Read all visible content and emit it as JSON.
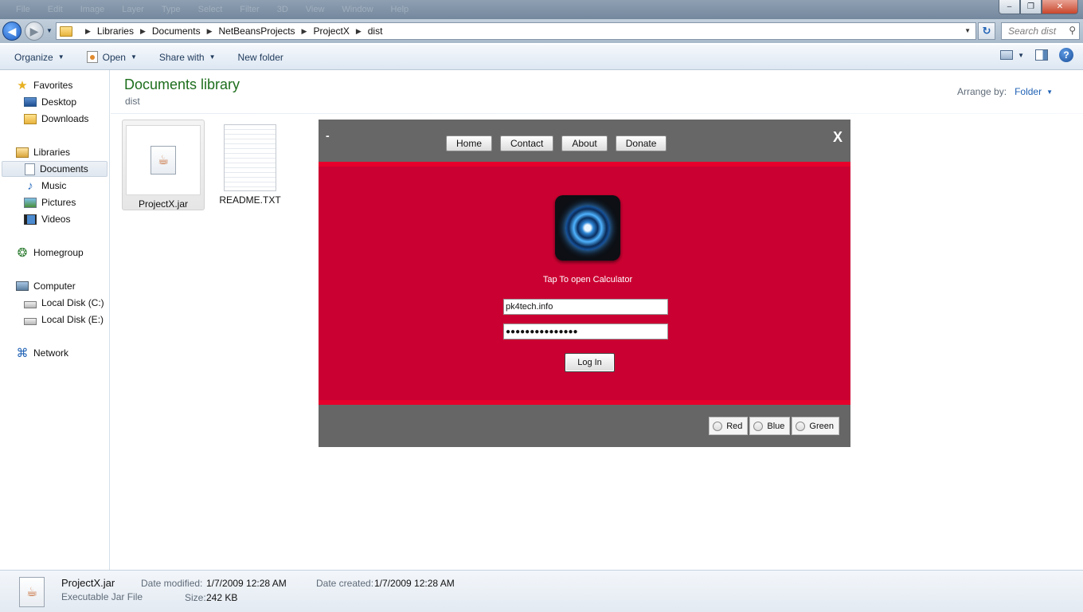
{
  "window": {
    "menu_ghost": [
      "File",
      "Edit",
      "Image",
      "Layer",
      "Type",
      "Select",
      "Filter",
      "3D",
      "View",
      "Window",
      "Help"
    ],
    "min_glyph": "–",
    "max_glyph": "❐",
    "close_glyph": "✕"
  },
  "address": {
    "crumbs": [
      "Libraries",
      "Documents",
      "NetBeansProjects",
      "ProjectX",
      "dist"
    ],
    "search_placeholder": "Search dist"
  },
  "commands": {
    "organize": "Organize",
    "open": "Open",
    "share_with": "Share with",
    "new_folder": "New folder"
  },
  "nav": {
    "favorites": "Favorites",
    "desktop": "Desktop",
    "downloads": "Downloads",
    "libraries": "Libraries",
    "documents": "Documents",
    "music": "Music",
    "pictures": "Pictures",
    "videos": "Videos",
    "homegroup": "Homegroup",
    "computer": "Computer",
    "local_c": "Local Disk (C:)",
    "local_e": "Local Disk (E:)",
    "network": "Network"
  },
  "library": {
    "title": "Documents library",
    "subtitle": "dist",
    "arrange_label": "Arrange by:",
    "arrange_value": "Folder"
  },
  "files": [
    {
      "name": "ProjectX.jar"
    },
    {
      "name": "README.TXT"
    }
  ],
  "app": {
    "minimize": "-",
    "close": "X",
    "nav": [
      "Home",
      "Contact",
      "About",
      "Donate"
    ],
    "tap_text": "Tap To open Calculator",
    "username": "pk4tech.info",
    "password": "●●●●●●●●●●●●●●●",
    "login": "Log In",
    "radios": [
      "Red",
      "Blue",
      "Green"
    ],
    "colors": {
      "top": "#676767",
      "red": "#cb0032",
      "stripe": "#e6002b"
    }
  },
  "details": {
    "name": "ProjectX.jar",
    "type": "Executable Jar File",
    "modified_label": "Date modified:",
    "modified_value": "1/7/2009 12:28 AM",
    "created_label": "Date created:",
    "created_value": "1/7/2009 12:28 AM",
    "size_label": "Size:",
    "size_value": "242 KB"
  }
}
